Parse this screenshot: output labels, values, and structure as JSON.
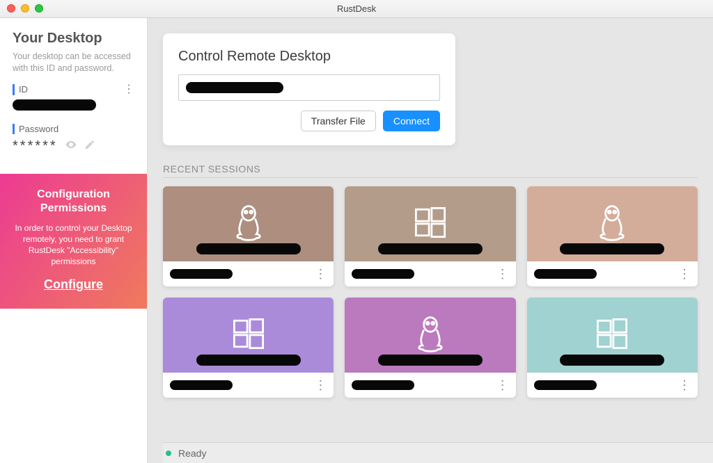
{
  "window": {
    "title": "RustDesk"
  },
  "sidebar": {
    "heading": "Your Desktop",
    "description": "Your desktop can be accessed with this ID and password.",
    "id_label": "ID",
    "id_value_redacted": true,
    "password_label": "Password",
    "password_mask": "******",
    "icons": {
      "more": "more-vert-icon",
      "eye": "eye-icon",
      "edit": "pencil-icon"
    }
  },
  "promo": {
    "title": "Configuration Permissions",
    "body": "In order to control your Desktop remotely, you need to grant RustDesk \"Accessibility\" permissions",
    "cta": "Configure"
  },
  "control": {
    "title": "Control Remote Desktop",
    "input_placeholder": "",
    "input_value_redacted": true,
    "transfer_label": "Transfer File",
    "connect_label": "Connect"
  },
  "recent": {
    "heading": "RECENT SESSIONS",
    "tiles": [
      {
        "os": "linux",
        "color": "c-a",
        "name_redacted": true,
        "sub_redacted": true
      },
      {
        "os": "windows",
        "color": "c-b",
        "name_redacted": true,
        "sub_redacted": true
      },
      {
        "os": "linux",
        "color": "c-c",
        "name_redacted": true,
        "sub_redacted": true
      },
      {
        "os": "windows",
        "color": "c-d",
        "name_redacted": true,
        "sub_redacted": true
      },
      {
        "os": "linux",
        "color": "c-e",
        "name_redacted": true,
        "sub_redacted": true
      },
      {
        "os": "windows",
        "color": "c-f",
        "name_redacted": true,
        "sub_redacted": true
      }
    ]
  },
  "status": {
    "text": "Ready",
    "state": "online",
    "color": "#27c18b"
  }
}
